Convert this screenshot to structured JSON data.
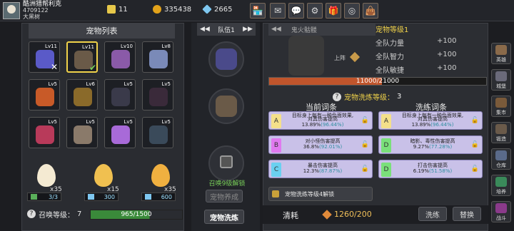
{
  "player": {
    "name": "酷洲猎帮利克",
    "id": "4709122",
    "title": "大黑树"
  },
  "resources": [
    {
      "name": "pencil-currency",
      "value": "11",
      "color": "#e6c84a"
    },
    {
      "name": "gold-coin",
      "value": "335438",
      "color": "#e2a21a"
    },
    {
      "name": "diamond",
      "value": "2665",
      "color": "#7ec7f0"
    }
  ],
  "toolbar_icons": [
    "shop-icon",
    "mail-icon",
    "chat-icon",
    "settings-icon",
    "gift-icon",
    "lottery-wheel-icon",
    "bag-icon"
  ],
  "pet_list": {
    "title": "宠物列表",
    "pets": [
      {
        "lv": "Lv11",
        "color": "#5a5ac8",
        "mark": "x"
      },
      {
        "lv": "Lv11",
        "color": "#6a5a48",
        "mark": "check",
        "selected": true
      },
      {
        "lv": "Lv10",
        "color": "#8a5aa8"
      },
      {
        "lv": "Lv8",
        "color": "#7a8ab8"
      },
      {
        "lv": "Lv5",
        "color": "#c85a28"
      },
      {
        "lv": "Lv6",
        "color": "#8a6a2a"
      },
      {
        "lv": "Lv5",
        "color": "#3a3a4a"
      },
      {
        "lv": "Lv5",
        "color": "#3a2a3a"
      },
      {
        "lv": "Lv5",
        "color": "#b83a5a"
      },
      {
        "lv": "Lv5",
        "color": "#8a7a6a"
      },
      {
        "lv": "Lv5",
        "color": "#a86ad8"
      },
      {
        "lv": "Lv5",
        "color": "#3a4a5a"
      }
    ]
  },
  "eggs": [
    {
      "count": "x35",
      "cost": "3/3",
      "cost_icon": "ticket"
    },
    {
      "count": "x15",
      "cost": "300",
      "cost_icon": "diamond"
    },
    {
      "count": "x35",
      "cost": "600",
      "cost_icon": "diamond"
    }
  ],
  "summon": {
    "label": "召唤等级：",
    "level": "7",
    "xp": "965/1500",
    "progress": 0.643
  },
  "team": {
    "title": "队伍1",
    "unlock_text": "召唤9级解锁",
    "pet_award_label": "宠物养成",
    "pet_wash_label": "宠物洗炼"
  },
  "detail": {
    "name": "鬼火骷髅",
    "level_label": "宠物等级1",
    "stats": [
      {
        "label": "全队力量",
        "value": "+100"
      },
      {
        "label": "全队智力",
        "value": "+100"
      },
      {
        "label": "全队敏捷",
        "value": "+100"
      }
    ],
    "hp": "11000/21000",
    "hp_progress": 0.52,
    "deploy_label": "上阵"
  },
  "wash": {
    "level_label": "宠物洗炼等级：",
    "level": "3",
    "current_title": "当前词条",
    "wash_title": "洗练词条",
    "current": [
      {
        "tag": "A",
        "line1": "目标身上每有一种负面效果,",
        "line2": "对其伤害提高",
        "value": "13.89%",
        "range": "(96.44%)",
        "color": "#f4e08a"
      },
      {
        "tag": "B",
        "line1": "",
        "line2": "对小怪伤害提高",
        "value": "36.8%",
        "range": "(92.01%)",
        "color": "#e07af0"
      },
      {
        "tag": "C",
        "line1": "",
        "line2": "暴击伤害提高",
        "value": "12.3%",
        "range": "(87.87%)",
        "color": "#6ad0f0"
      }
    ],
    "washed": [
      {
        "tag": "A",
        "line1": "目标身上每有一种负面效果,",
        "line2": "对其伤害提高",
        "value": "13.89%",
        "range": "(96.44%)",
        "color": "#f4e08a"
      },
      {
        "tag": "D",
        "line1": "",
        "line2": "暗影、毒性伤害提高",
        "value": "9.27%",
        "range": "(77.28%)",
        "color": "#7ae07a"
      },
      {
        "tag": "D",
        "line1": "",
        "line2": "打击伤害提高",
        "value": "6.19%",
        "range": "(51.58%)",
        "color": "#7ae07a"
      }
    ],
    "unlock_note": "宠物洗练等级4解锁",
    "cost_label": "清耗",
    "cost": "1260/200",
    "wash_btn": "洗练",
    "replace_btn": "替换"
  },
  "side_menu": [
    {
      "label": "英雄",
      "color": "#8a6a4a"
    },
    {
      "label": "城堡",
      "color": "#6a6a7a"
    },
    {
      "label": "集市",
      "color": "#7a5a3a"
    },
    {
      "label": "锻造",
      "color": "#6a5a4a"
    },
    {
      "label": "仓库",
      "color": "#5a6a8a"
    },
    {
      "label": "培养",
      "color": "#3a8a5a"
    },
    {
      "label": "战斗",
      "color": "#8a3a8a"
    }
  ]
}
